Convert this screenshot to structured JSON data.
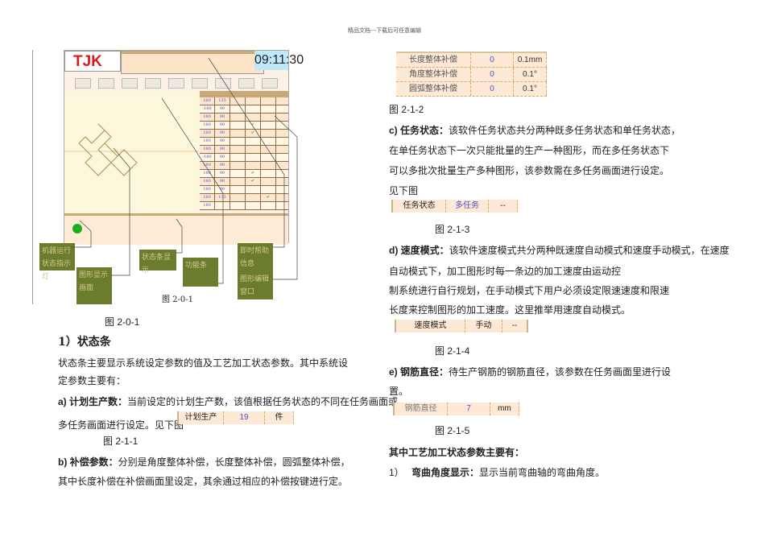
{
  "header": "精品文档---下载后可任意编辑",
  "figure": {
    "logo": "TJK",
    "clock": "09:11:30",
    "table_rows": [
      [
        "180",
        "135",
        "",
        "",
        ""
      ],
      [
        "-180",
        "90",
        "",
        "",
        ""
      ],
      [
        "180",
        "90",
        "",
        "",
        ""
      ],
      [
        "180",
        "90",
        "",
        "✔",
        ""
      ],
      [
        "180",
        "90",
        "",
        "✔",
        ""
      ],
      [
        "180",
        "90",
        "",
        "",
        ""
      ],
      [
        "180",
        "90",
        "",
        "",
        ""
      ],
      [
        "-180",
        "90",
        "",
        "",
        ""
      ],
      [
        "180",
        "90",
        "",
        "",
        ""
      ],
      [
        "180",
        "90",
        "",
        "✔",
        ""
      ],
      [
        "180",
        "90",
        "",
        "✔",
        ""
      ],
      [
        "180",
        "90",
        "",
        "",
        ""
      ],
      [
        "180",
        "135",
        "",
        "",
        "✔"
      ],
      [
        "180",
        "",
        "",
        "",
        ""
      ]
    ],
    "callouts": {
      "run_light": "机器运行状态指示灯",
      "graphic_view": "图形显示画面",
      "status_bar": "状态条显示",
      "function_bar": "功能条",
      "help_info": "即时帮助信息",
      "edit_window": "图形编辑窗口"
    },
    "inner_caption": "图 2-0-1",
    "caption": "图 2-0-1"
  },
  "left": {
    "section": "1）状态条",
    "p1": "状态条主要显示系统设定参数的值及工艺加工状态参数。其中系统设",
    "p2": "定参数主要有：",
    "a_label": "a) 计划生产数：",
    "a_text": "当前设定的计划生产数，该值根据任务状态的不同在任务画面或",
    "a_text2": "多任务画面进行设定。见下图",
    "plan_table": [
      "计划生产",
      "19",
      "件"
    ],
    "cap_211": "图 2-1-1",
    "b_label": "b) 补偿参数：",
    "b_text": "分别是角度整体补偿，长度整体补偿，圆弧整体补偿，",
    "b_text2": "其中长度补偿在补偿画面里设定，其余通过相应的补偿按键进行定。"
  },
  "right": {
    "comp_table": [
      [
        "长度整体补偿",
        "0",
        "0.1mm"
      ],
      [
        "角度整体补偿",
        "0",
        "0.1°"
      ],
      [
        "圆弧整体补偿",
        "0",
        "0.1°"
      ]
    ],
    "cap_212": "图 2-1-2",
    "c_label": "c) 任务状态：",
    "c_text": "该软件任务状态共分两种既多任务状态和单任务状态，",
    "c_2": "在单任务状态下一次只能批量的生产一种图形，而在多任务状态下",
    "c_3": "可以多批次批量生产多种图形，该参数需在多任务画面进行设定。",
    "c_4": "见下图",
    "task_table": [
      "任务状态",
      "多任务",
      "--"
    ],
    "cap_213": "图 2-1-3",
    "d_label": "d) 速度模式：",
    "d_text": "该软件速度模式共分两种既速度自动模式和速度手动模式，在速度",
    "d_2": "自动模式下，加工图形时每一条边的加工速度由运动控",
    "d_3": "制系统进行自行规划，在手动模式下用户必须设定限速速度和限速",
    "d_4": "长度来控制图形的加工速度。这里推举用速度自动模式。",
    "speed_table": [
      "速度模式",
      "手动",
      "--"
    ],
    "cap_214": "图 2-1-4",
    "e_label": "e) 钢筋直径：",
    "e_text": "待生产钢筋的钢筋直径，该参数在任务画面里进行设",
    "e_2": "置。",
    "dia_table": [
      "钢筋直径",
      "7",
      "mm"
    ],
    "cap_215": "图 2-1-5",
    "process_head": "其中工艺加工状态参数主要有：",
    "item1_num": "1）",
    "item1_label": "弯曲角度显示：",
    "item1_text": "显示当前弯曲轴的弯曲角度。"
  }
}
